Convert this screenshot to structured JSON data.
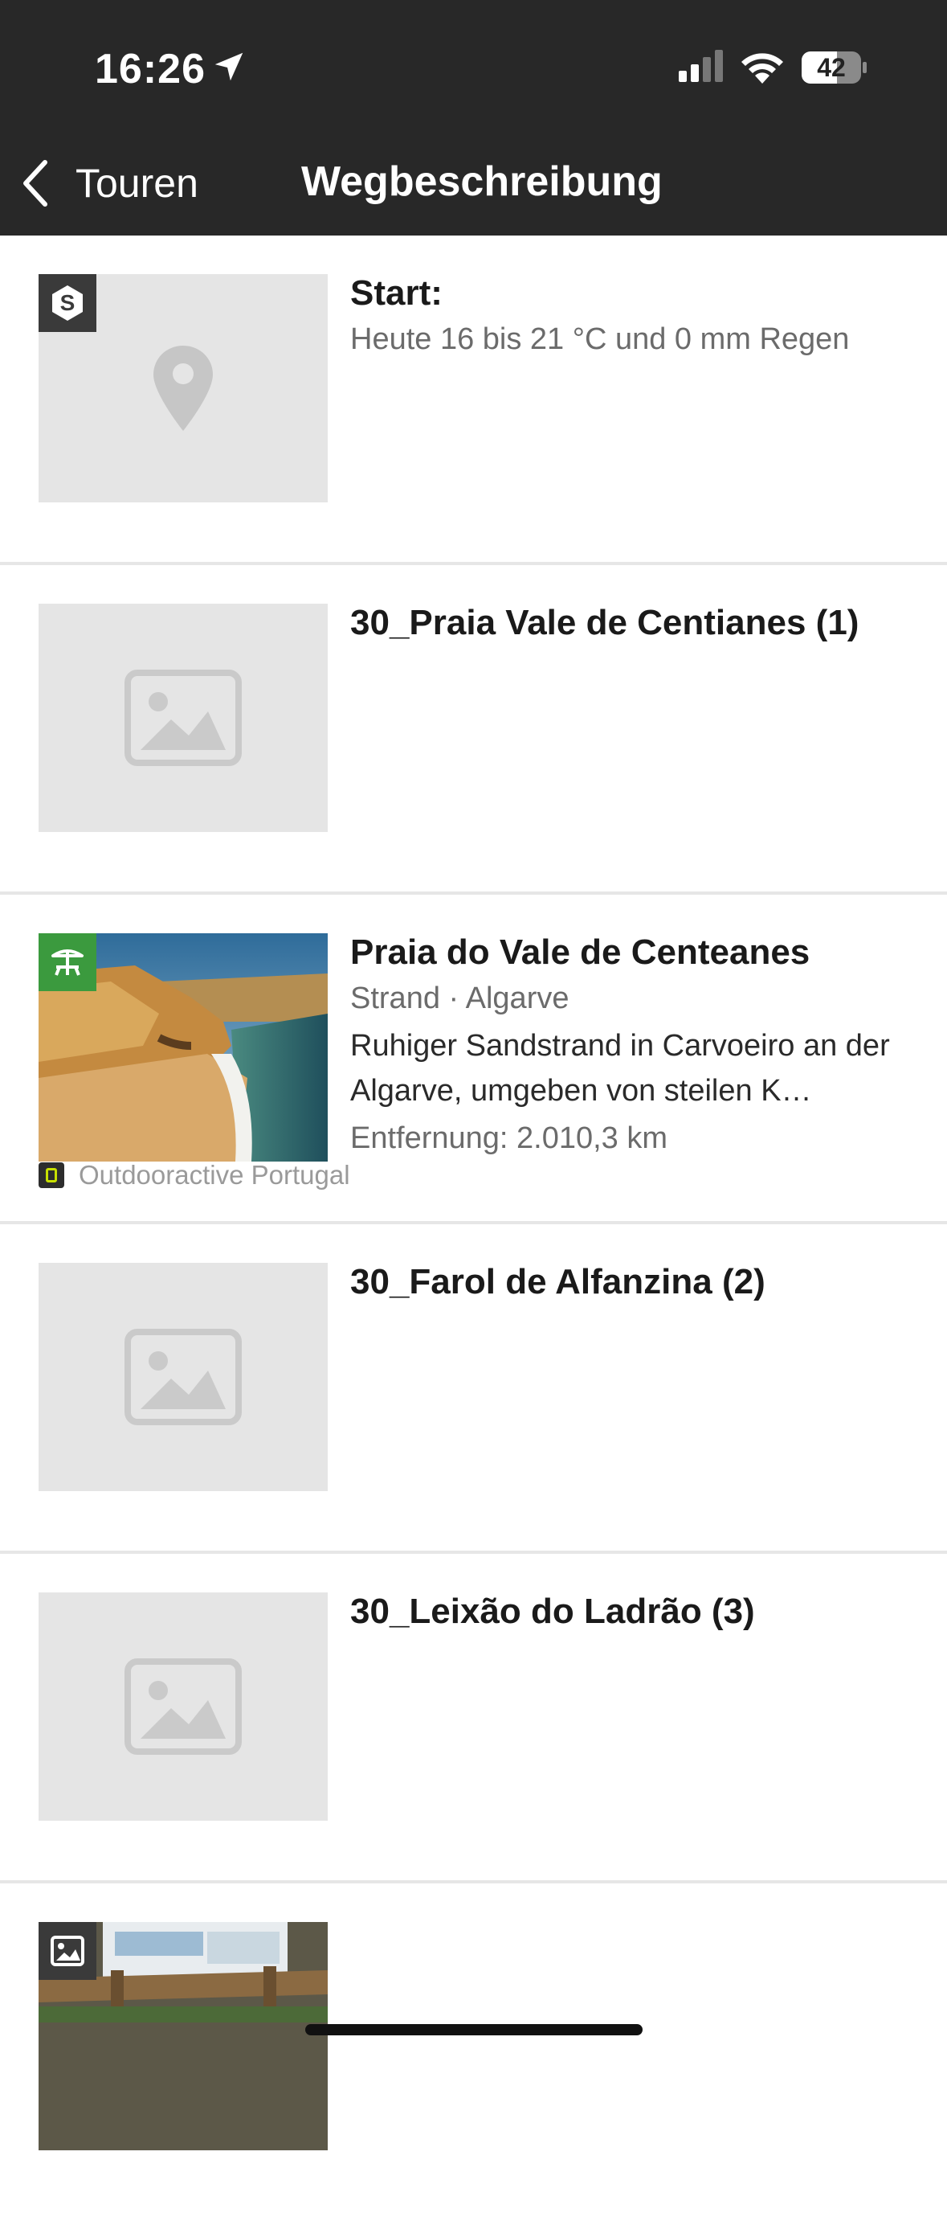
{
  "status_bar": {
    "time": "16:26",
    "battery": "42"
  },
  "nav": {
    "back_label": "Touren",
    "title": "Wegbeschreibung"
  },
  "rows": [
    {
      "title": "Start:",
      "subtitle": "Heute 16 bis 21 °C und 0 mm Regen",
      "badge": "S"
    },
    {
      "title": "30_Praia Vale de Centianes (1)"
    },
    {
      "title": "Praia do Vale de Centeanes",
      "category": "Strand · Algarve",
      "description": "Ruhiger Sandstrand in Carvoeiro an der Algarve, umgeben von steilen K…",
      "distance": "Entfernung: 2.010,3 km",
      "source": "Outdooractive Portugal"
    },
    {
      "title": "30_Farol de Alfanzina (2)"
    },
    {
      "title": "30_Leixão do Ladrão (3)"
    }
  ],
  "colors": {
    "header_bg": "#282828",
    "beach_badge": "#3b9a3e",
    "placeholder": "#e5e5e5"
  }
}
